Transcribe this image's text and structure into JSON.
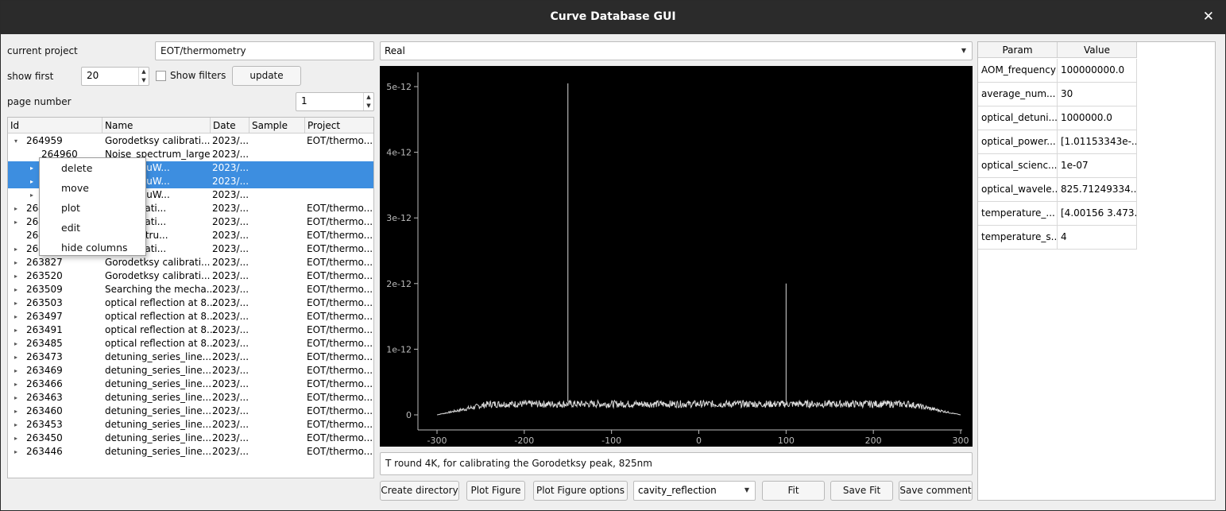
{
  "window": {
    "title": "Curve Database GUI",
    "close_glyph": "✕"
  },
  "controls": {
    "current_project_label": "current project",
    "current_project_value": "EOT/thermometry",
    "show_first_label": "show first",
    "show_first_value": "20",
    "show_filters_label": "Show filters",
    "show_filters_checked": false,
    "update_label": "update",
    "page_number_label": "page number",
    "page_number_value": "1"
  },
  "tree": {
    "columns": [
      "Id",
      "Name",
      "Date",
      "Sample",
      "Project"
    ],
    "rows": [
      {
        "id": "264959",
        "name": "Gorodetksy calibrati...",
        "date": "2023/...",
        "sample": "",
        "project": "EOT/thermo...",
        "expand": "▾",
        "indent": 0,
        "selected": false
      },
      {
        "id": "264960",
        "name": "Noise_spectrum_large",
        "date": "2023/...",
        "sample": "",
        "project": "",
        "expand": "",
        "indent": 1,
        "selected": false
      },
      {
        "id": "",
        "name": "z_P_0.02uW...",
        "date": "2023/...",
        "sample": "",
        "project": "",
        "expand": "▸",
        "indent": 1,
        "selected": true
      },
      {
        "id": "",
        "name": "z_P_0.10uW...",
        "date": "2023/...",
        "sample": "",
        "project": "",
        "expand": "▸",
        "indent": 1,
        "selected": true
      },
      {
        "id": "",
        "name": "z_P_2.01uW...",
        "date": "2023/...",
        "sample": "",
        "project": "",
        "expand": "▸",
        "indent": 1,
        "selected": false
      },
      {
        "id": "264",
        "name": "sy calibrati...",
        "date": "2023/...",
        "sample": "",
        "project": "EOT/thermo...",
        "expand": "▸",
        "indent": 0,
        "selected": false
      },
      {
        "id": "264",
        "name": "sy calibrati...",
        "date": "2023/...",
        "sample": "",
        "project": "EOT/thermo...",
        "expand": "▸",
        "indent": 0,
        "selected": false
      },
      {
        "id": "264",
        "name": "ise_spectru...",
        "date": "2023/...",
        "sample": "",
        "project": "EOT/thermo...",
        "expand": "",
        "indent": 0,
        "selected": false
      },
      {
        "id": "264",
        "name": "sy calibrati...",
        "date": "2023/...",
        "sample": "",
        "project": "EOT/thermo...",
        "expand": "▸",
        "indent": 0,
        "selected": false
      },
      {
        "id": "263827",
        "name": "Gorodetksy calibrati...",
        "date": "2023/...",
        "sample": "",
        "project": "EOT/thermo...",
        "expand": "▸",
        "indent": 0,
        "selected": false
      },
      {
        "id": "263520",
        "name": "Gorodetksy calibrati...",
        "date": "2023/...",
        "sample": "",
        "project": "EOT/thermo...",
        "expand": "▸",
        "indent": 0,
        "selected": false
      },
      {
        "id": "263509",
        "name": "Searching the mecha...",
        "date": "2023/...",
        "sample": "",
        "project": "EOT/thermo...",
        "expand": "▸",
        "indent": 0,
        "selected": false
      },
      {
        "id": "263503",
        "name": "optical reflection at 8...",
        "date": "2023/...",
        "sample": "",
        "project": "EOT/thermo...",
        "expand": "▸",
        "indent": 0,
        "selected": false
      },
      {
        "id": "263497",
        "name": "optical reflection at 8...",
        "date": "2023/...",
        "sample": "",
        "project": "EOT/thermo...",
        "expand": "▸",
        "indent": 0,
        "selected": false
      },
      {
        "id": "263491",
        "name": "optical reflection at 8...",
        "date": "2023/...",
        "sample": "",
        "project": "EOT/thermo...",
        "expand": "▸",
        "indent": 0,
        "selected": false
      },
      {
        "id": "263485",
        "name": "optical reflection at 8...",
        "date": "2023/...",
        "sample": "",
        "project": "EOT/thermo...",
        "expand": "▸",
        "indent": 0,
        "selected": false
      },
      {
        "id": "263473",
        "name": "detuning_series_line...",
        "date": "2023/...",
        "sample": "",
        "project": "EOT/thermo...",
        "expand": "▸",
        "indent": 0,
        "selected": false
      },
      {
        "id": "263469",
        "name": "detuning_series_line...",
        "date": "2023/...",
        "sample": "",
        "project": "EOT/thermo...",
        "expand": "▸",
        "indent": 0,
        "selected": false
      },
      {
        "id": "263466",
        "name": "detuning_series_line...",
        "date": "2023/...",
        "sample": "",
        "project": "EOT/thermo...",
        "expand": "▸",
        "indent": 0,
        "selected": false
      },
      {
        "id": "263463",
        "name": "detuning_series_line...",
        "date": "2023/...",
        "sample": "",
        "project": "EOT/thermo...",
        "expand": "▸",
        "indent": 0,
        "selected": false
      },
      {
        "id": "263460",
        "name": "detuning_series_line...",
        "date": "2023/...",
        "sample": "",
        "project": "EOT/thermo...",
        "expand": "▸",
        "indent": 0,
        "selected": false
      },
      {
        "id": "263453",
        "name": "detuning_series_line...",
        "date": "2023/...",
        "sample": "",
        "project": "EOT/thermo...",
        "expand": "▸",
        "indent": 0,
        "selected": false
      },
      {
        "id": "263450",
        "name": "detuning_series_line...",
        "date": "2023/...",
        "sample": "",
        "project": "EOT/thermo...",
        "expand": "▸",
        "indent": 0,
        "selected": false
      },
      {
        "id": "263446",
        "name": "detuning_series_line...",
        "date": "2023/...",
        "sample": "",
        "project": "EOT/thermo...",
        "expand": "▸",
        "indent": 0,
        "selected": false
      }
    ]
  },
  "context_menu": {
    "items": [
      "delete",
      "move",
      "plot",
      "edit",
      "hide columns"
    ]
  },
  "plot_panel": {
    "mode_select": "Real",
    "comment": "T round 4K, for calibrating the Gorodetksy peak, 825nm",
    "buttons": {
      "create_directory": "Create directory",
      "plot_figure": "Plot Figure",
      "plot_figure_options": "Plot Figure options",
      "fit_type": "cavity_reflection",
      "fit": "Fit",
      "save_fit": "Save Fit",
      "save_comment": "Save comment"
    },
    "colors": {
      "background": "#000000",
      "trace": "#d9d9d9",
      "axis": "#bbbbbb"
    }
  },
  "chart_data": {
    "type": "line",
    "title": "",
    "xlabel": "",
    "ylabel": "",
    "xlim": [
      -300,
      300
    ],
    "ylim": [
      0,
      5e-12
    ],
    "x_ticks": [
      -300,
      -200,
      -100,
      0,
      100,
      200,
      300
    ],
    "x_tick_labels": [
      "-300",
      "-200",
      "-100",
      "0",
      "100",
      "200",
      "300"
    ],
    "y_ticks": [
      0,
      1e-12,
      2e-12,
      3e-12,
      4e-12,
      5e-12
    ],
    "y_tick_labels": [
      "0",
      "1e-12",
      "2e-12",
      "3e-12",
      "4e-12",
      "5e-12"
    ],
    "grid": false,
    "series": [
      {
        "noise_floor": {
          "x_start": -300,
          "x_end": 300,
          "level": 2e-13,
          "edge_level": 0
        },
        "peaks": [
          {
            "x": -150,
            "y": 5.05e-12
          },
          {
            "x": 100,
            "y": 2e-12
          }
        ]
      }
    ]
  },
  "params": {
    "headers": [
      "Param",
      "Value"
    ],
    "rows": [
      {
        "param": "AOM_frequency",
        "value": "100000000.0"
      },
      {
        "param": "average_num...",
        "value": "30"
      },
      {
        "param": "optical_detuni...",
        "value": "1000000.0"
      },
      {
        "param": "optical_power...",
        "value": "[1.01153343e-..."
      },
      {
        "param": "optical_scienc...",
        "value": "1e-07"
      },
      {
        "param": "optical_wavele...",
        "value": "825.71249334..."
      },
      {
        "param": "temperature_...",
        "value": "[4.00156 3.473..."
      },
      {
        "param": "temperature_s...",
        "value": "4"
      }
    ]
  }
}
